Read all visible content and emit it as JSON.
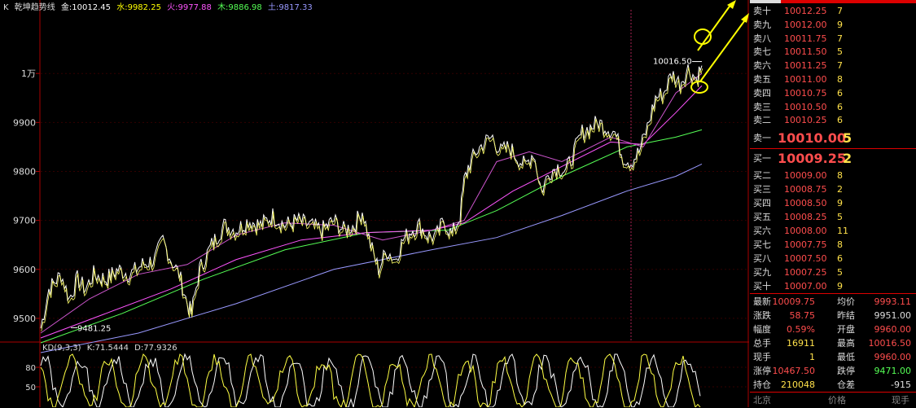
{
  "legend": {
    "prefix": "K",
    "name": "乾坤趋势线",
    "jin": "金:10012.45",
    "shui": "水:9982.25",
    "huo": "火:9977.88",
    "mu": "木:9886.98",
    "tu": "土:9817.33",
    "colors": {
      "jin": "#ffffff",
      "shui": "#ffff00",
      "huo": "#ff55ff",
      "mu": "#55ff55",
      "tu": "#9999ff"
    }
  },
  "axis": {
    "y_labels": [
      "1万",
      "9900",
      "9800",
      "9700",
      "9600",
      "9500"
    ],
    "kd_labels": [
      "80",
      "50"
    ]
  },
  "annotations": {
    "high_label": "10016.50",
    "low_label": "9481.25"
  },
  "kd": {
    "title": "KD(9,3,3)",
    "k": "K:71.5444",
    "d": "D:77.9326"
  },
  "chart_data": {
    "type": "line",
    "title": "",
    "ylim": [
      9455,
      10130
    ],
    "series": [
      {
        "name": "金",
        "color": "#ffffff",
        "last": 10012.45
      },
      {
        "name": "水",
        "color": "#ffff00",
        "last": 9982.25
      },
      {
        "name": "火",
        "color": "#ff55ff",
        "last": 9977.88
      },
      {
        "name": "木",
        "color": "#55ff55",
        "last": 9886.98
      },
      {
        "name": "土",
        "color": "#9999ff",
        "last": 9817.33
      }
    ],
    "price_points": [
      [
        0,
        9480
      ],
      [
        10,
        9560
      ],
      [
        25,
        9590
      ],
      [
        35,
        9540
      ],
      [
        45,
        9580
      ],
      [
        55,
        9560
      ],
      [
        65,
        9590
      ],
      [
        80,
        9580
      ],
      [
        95,
        9600
      ],
      [
        110,
        9590
      ],
      [
        125,
        9610
      ],
      [
        140,
        9620
      ],
      [
        150,
        9660
      ],
      [
        160,
        9620
      ],
      [
        170,
        9590
      ],
      [
        180,
        9530
      ],
      [
        185,
        9510
      ],
      [
        195,
        9600
      ],
      [
        210,
        9650
      ],
      [
        225,
        9690
      ],
      [
        240,
        9680
      ],
      [
        255,
        9700
      ],
      [
        270,
        9690
      ],
      [
        285,
        9710
      ],
      [
        300,
        9690
      ],
      [
        315,
        9700
      ],
      [
        330,
        9690
      ],
      [
        345,
        9680
      ],
      [
        360,
        9700
      ],
      [
        372,
        9680
      ],
      [
        385,
        9690
      ],
      [
        395,
        9720
      ],
      [
        405,
        9650
      ],
      [
        415,
        9600
      ],
      [
        425,
        9640
      ],
      [
        435,
        9620
      ],
      [
        445,
        9660
      ],
      [
        455,
        9680
      ],
      [
        465,
        9690
      ],
      [
        475,
        9670
      ],
      [
        485,
        9665
      ],
      [
        495,
        9700
      ],
      [
        505,
        9670
      ],
      [
        515,
        9710
      ],
      [
        520,
        9780
      ],
      [
        525,
        9810
      ],
      [
        535,
        9840
      ],
      [
        545,
        9860
      ],
      [
        555,
        9870
      ],
      [
        565,
        9840
      ],
      [
        575,
        9850
      ],
      [
        585,
        9830
      ],
      [
        595,
        9810
      ],
      [
        605,
        9840
      ],
      [
        615,
        9760
      ],
      [
        625,
        9800
      ],
      [
        635,
        9810
      ],
      [
        645,
        9800
      ],
      [
        655,
        9840
      ],
      [
        665,
        9880
      ],
      [
        675,
        9890
      ],
      [
        685,
        9900
      ],
      [
        695,
        9890
      ],
      [
        705,
        9880
      ],
      [
        715,
        9830
      ],
      [
        725,
        9820
      ],
      [
        735,
        9840
      ],
      [
        745,
        9890
      ],
      [
        755,
        9950
      ],
      [
        765,
        9960
      ],
      [
        775,
        10000
      ],
      [
        785,
        9980
      ],
      [
        795,
        10010
      ],
      [
        805,
        9990
      ],
      [
        812,
        10016
      ]
    ],
    "ma_fast": [
      [
        0,
        9470
      ],
      [
        60,
        9540
      ],
      [
        120,
        9590
      ],
      [
        180,
        9610
      ],
      [
        240,
        9670
      ],
      [
        300,
        9695
      ],
      [
        360,
        9690
      ],
      [
        420,
        9660
      ],
      [
        480,
        9680
      ],
      [
        520,
        9700
      ],
      [
        560,
        9820
      ],
      [
        600,
        9840
      ],
      [
        640,
        9820
      ],
      [
        700,
        9870
      ],
      [
        740,
        9850
      ],
      [
        780,
        9960
      ],
      [
        812,
        10000
      ]
    ],
    "ma_mid": [
      [
        0,
        9460
      ],
      [
        80,
        9510
      ],
      [
        160,
        9560
      ],
      [
        240,
        9620
      ],
      [
        320,
        9660
      ],
      [
        400,
        9675
      ],
      [
        480,
        9680
      ],
      [
        520,
        9695
      ],
      [
        580,
        9760
      ],
      [
        640,
        9810
      ],
      [
        700,
        9860
      ],
      [
        740,
        9855
      ],
      [
        780,
        9920
      ],
      [
        812,
        9975
      ]
    ],
    "ma_slow": [
      [
        0,
        9450
      ],
      [
        100,
        9510
      ],
      [
        200,
        9580
      ],
      [
        300,
        9640
      ],
      [
        400,
        9675
      ],
      [
        500,
        9680
      ],
      [
        560,
        9720
      ],
      [
        640,
        9790
      ],
      [
        720,
        9850
      ],
      [
        780,
        9870
      ],
      [
        812,
        9885
      ]
    ],
    "ma_long": [
      [
        0,
        9430
      ],
      [
        120,
        9470
      ],
      [
        240,
        9530
      ],
      [
        360,
        9600
      ],
      [
        480,
        9640
      ],
      [
        560,
        9665
      ],
      [
        640,
        9710
      ],
      [
        720,
        9760
      ],
      [
        780,
        9790
      ],
      [
        812,
        9815
      ]
    ]
  },
  "quote": {
    "sell": [
      {
        "label": "卖十",
        "price": "10012.25",
        "vol": "7"
      },
      {
        "label": "卖九",
        "price": "10012.00",
        "vol": "9"
      },
      {
        "label": "卖八",
        "price": "10011.75",
        "vol": "7"
      },
      {
        "label": "卖七",
        "price": "10011.50",
        "vol": "5"
      },
      {
        "label": "卖六",
        "price": "10011.25",
        "vol": "7"
      },
      {
        "label": "卖五",
        "price": "10011.00",
        "vol": "8"
      },
      {
        "label": "卖四",
        "price": "10010.75",
        "vol": "6"
      },
      {
        "label": "卖三",
        "price": "10010.50",
        "vol": "6"
      },
      {
        "label": "卖二",
        "price": "10010.25",
        "vol": "6"
      },
      {
        "label": "卖一",
        "price": "10010.00",
        "vol": "5"
      }
    ],
    "buy": [
      {
        "label": "买一",
        "price": "10009.25",
        "vol": "2"
      },
      {
        "label": "买二",
        "price": "10009.00",
        "vol": "8"
      },
      {
        "label": "买三",
        "price": "10008.75",
        "vol": "2"
      },
      {
        "label": "买四",
        "price": "10008.50",
        "vol": "9"
      },
      {
        "label": "买五",
        "price": "10008.25",
        "vol": "5"
      },
      {
        "label": "买六",
        "price": "10008.00",
        "vol": "11"
      },
      {
        "label": "买七",
        "price": "10007.75",
        "vol": "8"
      },
      {
        "label": "买八",
        "price": "10007.50",
        "vol": "6"
      },
      {
        "label": "买九",
        "price": "10007.25",
        "vol": "5"
      },
      {
        "label": "买十",
        "price": "10007.00",
        "vol": "9"
      }
    ],
    "stats": [
      {
        "l1": "最新",
        "v1": "10009.75",
        "c1": "#ff4d4d",
        "l2": "均价",
        "v2": "9993.11",
        "c2": "#ff4d4d"
      },
      {
        "l1": "涨跌",
        "v1": "58.75",
        "c1": "#ff4d4d",
        "l2": "昨结",
        "v2": "9951.00",
        "c2": "#dddddd"
      },
      {
        "l1": "幅度",
        "v1": "0.59%",
        "c1": "#ff4d4d",
        "l2": "开盘",
        "v2": "9960.00",
        "c2": "#ff4d4d"
      },
      {
        "l1": "总手",
        "v1": "16911",
        "c1": "#ffe14a",
        "l2": "最高",
        "v2": "10016.50",
        "c2": "#ff4d4d"
      },
      {
        "l1": "现手",
        "v1": "1",
        "c1": "#ffe14a",
        "l2": "最低",
        "v2": "9960.00",
        "c2": "#ff4d4d"
      },
      {
        "l1": "涨停",
        "v1": "10467.50",
        "c1": "#ff4d4d",
        "l2": "跌停",
        "v2": "9471.00",
        "c2": "#55ff55"
      },
      {
        "l1": "持仓",
        "v1": "210048",
        "c1": "#ffe14a",
        "l2": "仓差",
        "v2": "-915",
        "c2": "#dddddd"
      }
    ],
    "footer": {
      "location": "北京",
      "price": "价格",
      "hand": "现手"
    }
  }
}
